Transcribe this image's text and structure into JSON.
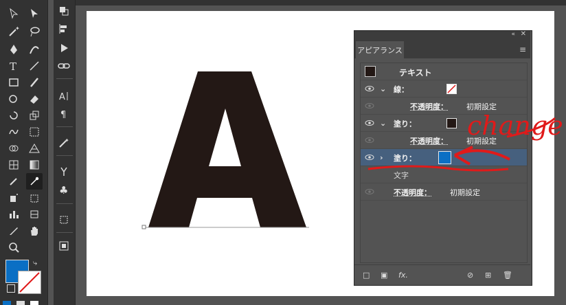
{
  "panel": {
    "tab_label": "アピアランス",
    "rows": [
      {
        "label": "テキスト"
      },
      {
        "label": "線：",
        "chevron": "⌄"
      },
      {
        "label": "不透明度：",
        "value": "初期設定"
      },
      {
        "label": "塗り：",
        "chevron": "⌄"
      },
      {
        "label": "不透明度：",
        "value": "初期設定"
      },
      {
        "label": "塗り：",
        "chevron": "›"
      },
      {
        "label": "文字"
      },
      {
        "label": "不透明度：",
        "value": "初期設定"
      }
    ],
    "footer": {
      "fx_label": "fx."
    }
  },
  "annotation": {
    "text": "change"
  },
  "colors": {
    "fill_swatch": "#0a6fc4",
    "letter": "#231815",
    "annotation": "#e01a1a"
  },
  "letter": "A"
}
